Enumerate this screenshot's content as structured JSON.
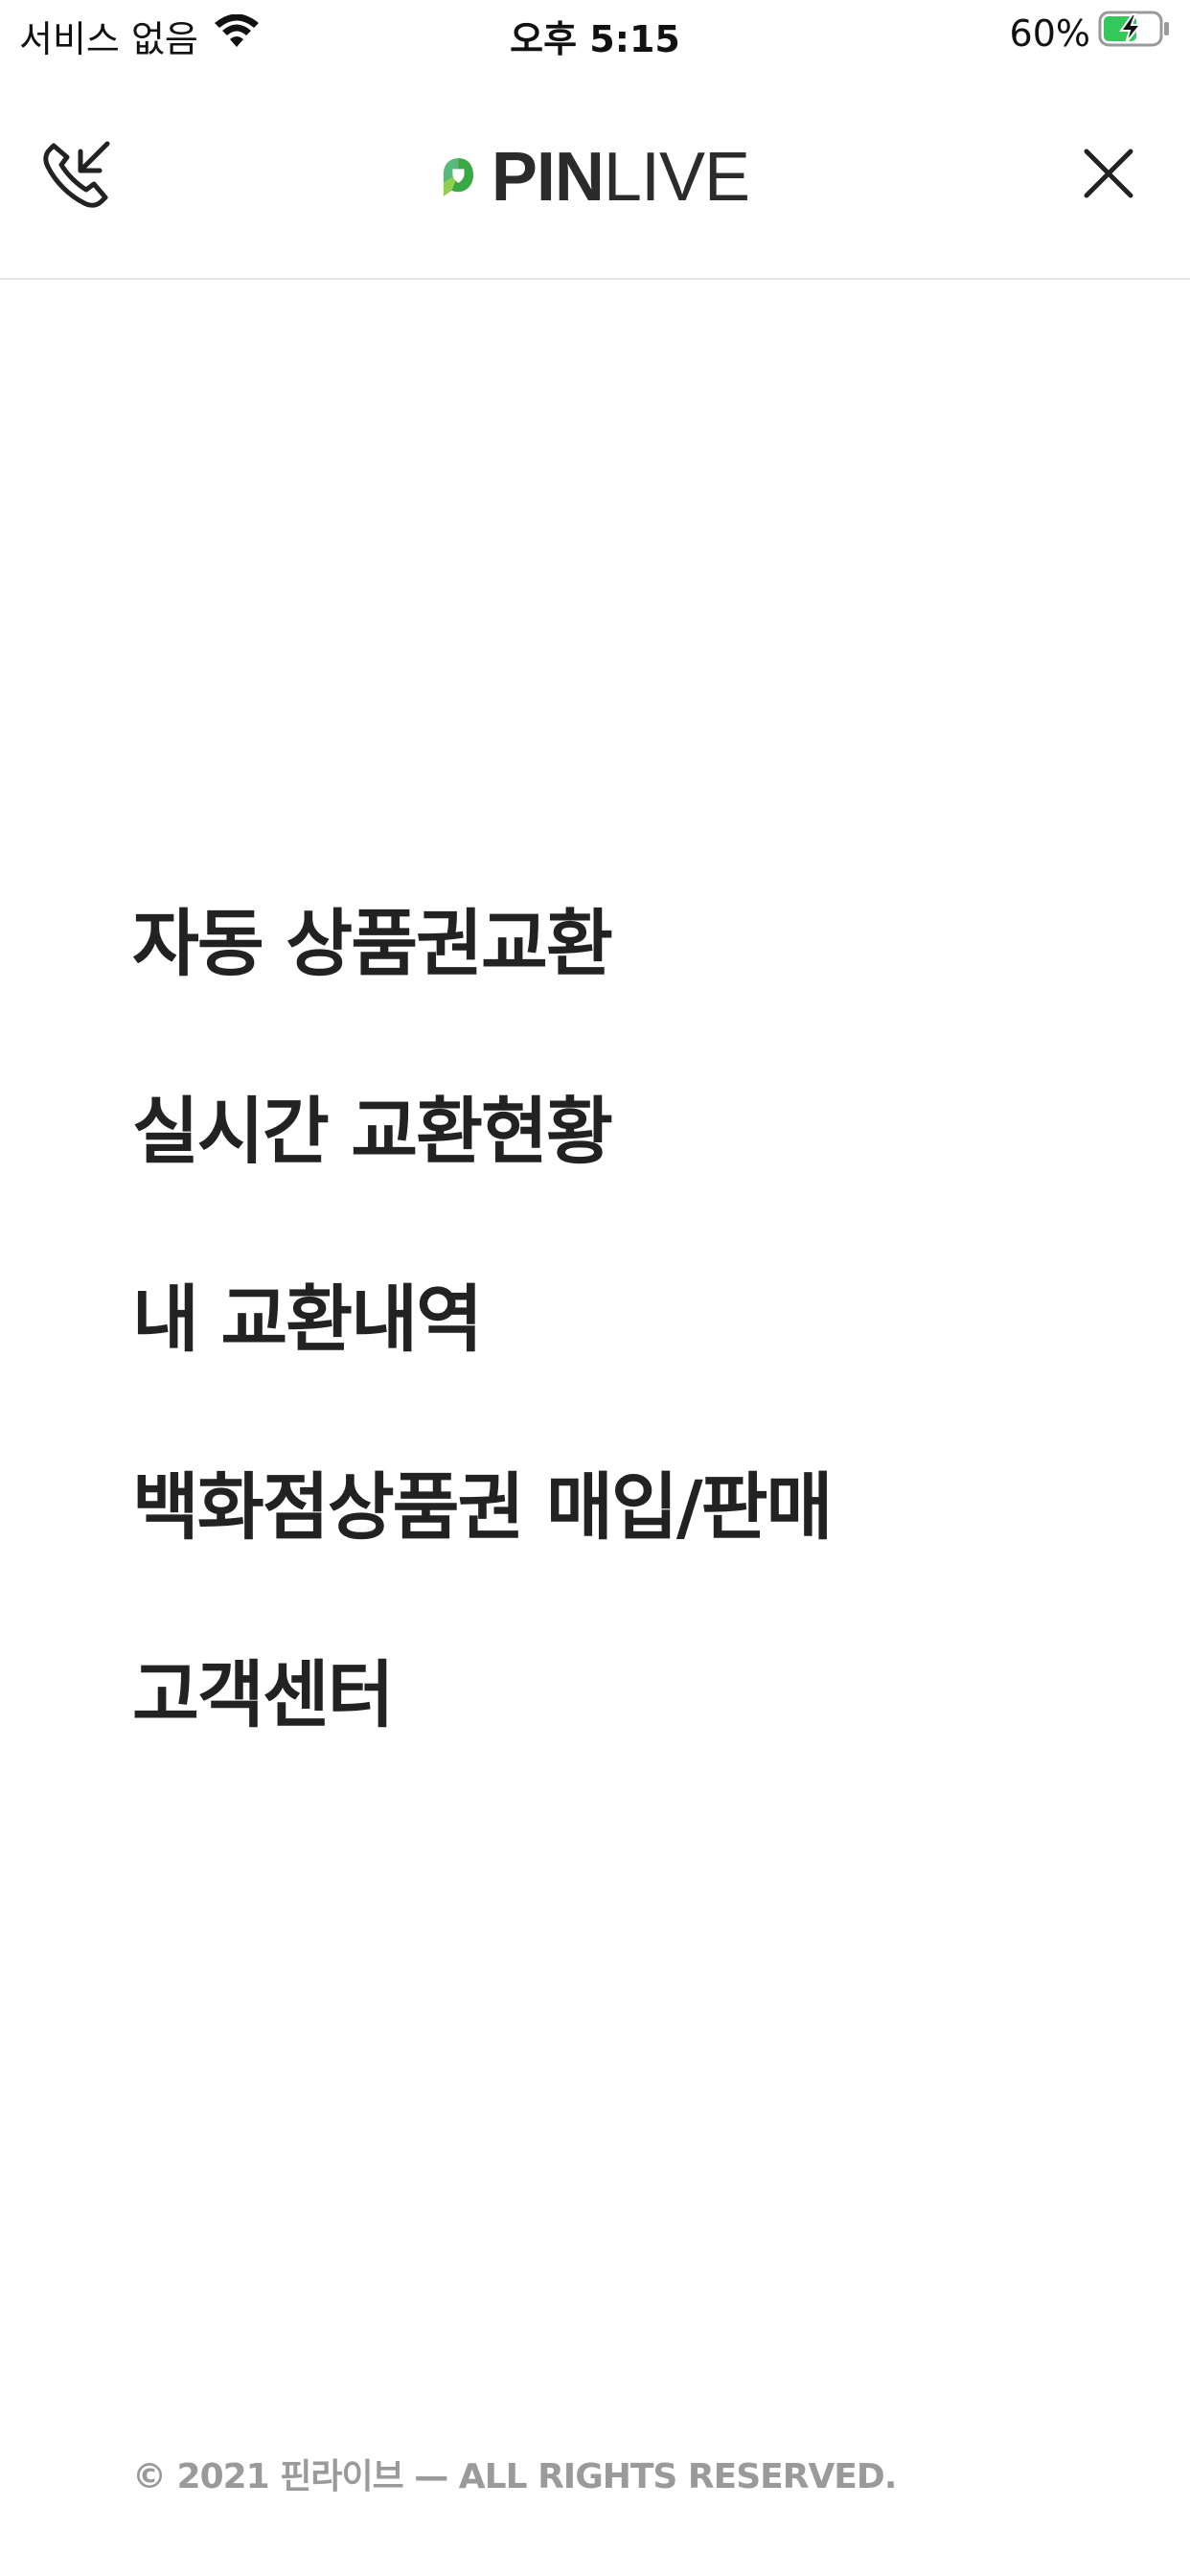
{
  "status_bar": {
    "carrier": "서비스 없음",
    "time": "오후 5:15",
    "battery": "60%"
  },
  "header": {
    "logo_bold": "PIN",
    "logo_light": "LIVE",
    "call_icon": "phone-incoming-icon",
    "close_icon": "close-icon"
  },
  "menu": {
    "items": [
      {
        "label": "자동 상품권교환"
      },
      {
        "label": "실시간 교환현황"
      },
      {
        "label": "내 교환내역"
      },
      {
        "label": "백화점상품권 매입/판매"
      },
      {
        "label": "고객센터"
      }
    ]
  },
  "footer": {
    "copyright": "© 2021 핀라이브 — ALL RIGHTS RESERVED."
  },
  "colors": {
    "logo_green_dark": "#3aa845",
    "logo_green_light": "#8fd14f",
    "logo_teal": "#2aa7a0",
    "battery_green": "#34c759"
  }
}
